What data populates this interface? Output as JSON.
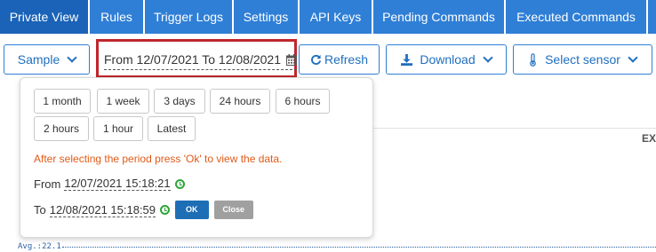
{
  "tabs": [
    {
      "label": "Private View"
    },
    {
      "label": "Rules"
    },
    {
      "label": "Trigger Logs"
    },
    {
      "label": "Settings"
    },
    {
      "label": "API Keys"
    },
    {
      "label": "Pending Commands"
    },
    {
      "label": "Executed Commands"
    }
  ],
  "toolbar": {
    "sample_label": "Sample",
    "range_text": "From 12/07/2021 To 12/08/2021",
    "refresh_label": "Refresh",
    "download_label": "Download",
    "select_sensor_label": "Select sensor"
  },
  "popover": {
    "presets_row1": [
      "1 month",
      "1 week",
      "3 days",
      "24 hours",
      "6 hours"
    ],
    "presets_row2": [
      "2 hours",
      "1 hour",
      "Latest"
    ],
    "message": "After selecting the period press 'Ok' to view the data.",
    "from_label": "From",
    "from_value": "12/07/2021 15:18:21",
    "to_label": "To",
    "to_value": "12/08/2021 15:18:59",
    "ok_label": "OK",
    "close_label": "Close"
  },
  "background": {
    "ex_text": "EX",
    "avg_text": "Avg.:22.1"
  },
  "colors": {
    "tab_bg": "#2f7fd6",
    "tab_active": "#1a63b8",
    "highlight_border": "#c0262d",
    "message": "#e05a18",
    "ok_bg": "#1e6eb6",
    "close_bg": "#a0a0a0"
  }
}
